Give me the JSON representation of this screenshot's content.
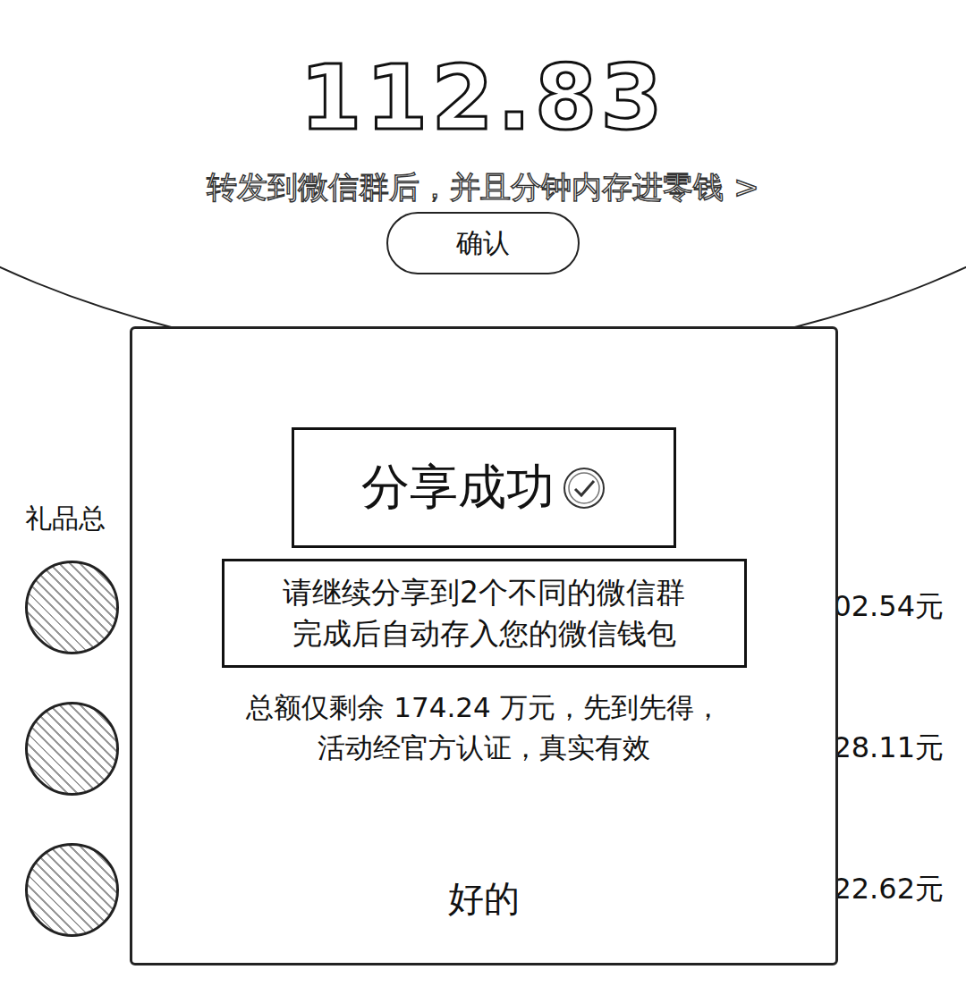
{
  "amount": "112.83",
  "notice": "转发到微信群后，并且分钟内存进零钱 >",
  "confirm_button": "确认",
  "gift_total_label": "礼品总",
  "gifts": [
    {
      "amount": "02.54元"
    },
    {
      "amount": "28.11元"
    },
    {
      "amount": "22.62元"
    }
  ],
  "dialog": {
    "title": "分享成功",
    "instruction_lines": [
      "请继续分享到2个不同的微信群",
      "完成后自动存入您的微信钱包"
    ],
    "info_lines": [
      "总额仅剩余 174.24 万元，先到先得，",
      "活动经官方认证，真实有效"
    ],
    "ok_button": "好的"
  }
}
